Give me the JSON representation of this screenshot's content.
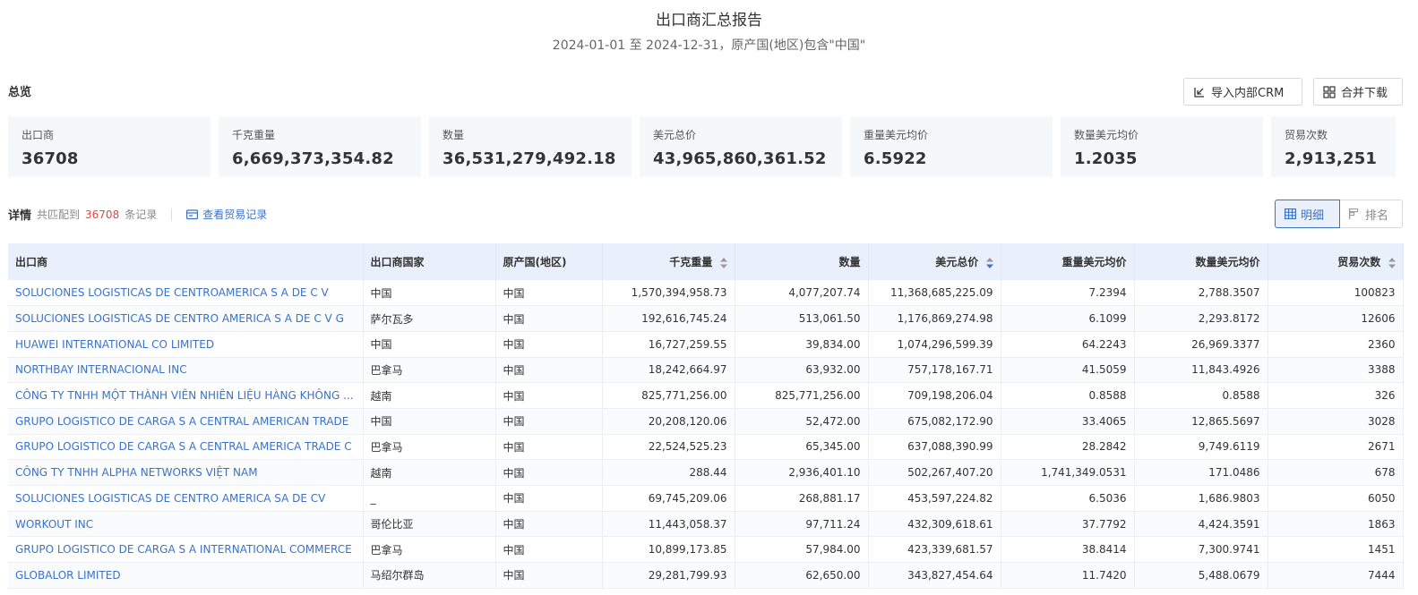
{
  "header": {
    "title": "出口商汇总报告",
    "subtitle": "2024-01-01 至 2024-12-31，原产国(地区)包含\"中国\""
  },
  "overview": {
    "label": "总览",
    "import_crm_label": "导入内部CRM",
    "merge_download_label": "合并下载"
  },
  "stats": [
    {
      "label": "出口商",
      "value": "36708"
    },
    {
      "label": "千克重量",
      "value": "6,669,373,354.82"
    },
    {
      "label": "数量",
      "value": "36,531,279,492.18"
    },
    {
      "label": "美元总价",
      "value": "43,965,860,361.52"
    },
    {
      "label": "重量美元均价",
      "value": "6.5922"
    },
    {
      "label": "数量美元均价",
      "value": "1.2035"
    },
    {
      "label": "贸易次数",
      "value": "2,913,251"
    }
  ],
  "details": {
    "label": "详情",
    "match_prefix": "共匹配到",
    "match_count": "36708",
    "match_suffix": "条记录",
    "view_records_label": "查看贸易记录",
    "view_detail_label": "明细",
    "view_rank_label": "排名"
  },
  "table": {
    "columns": [
      "出口商",
      "出口商国家",
      "原产国(地区)",
      "千克重量",
      "数量",
      "美元总价",
      "重量美元均价",
      "数量美元均价",
      "贸易次数"
    ],
    "rows": [
      [
        "SOLUCIONES LOGISTICAS DE CENTROAMERICA S A DE C V",
        "中国",
        "中国",
        "1,570,394,958.73",
        "4,077,207.74",
        "11,368,685,225.09",
        "7.2394",
        "2,788.3507",
        "100823"
      ],
      [
        "SOLUCIONES LOGISTICAS DE CENTRO AMERICA S A DE C V G",
        "萨尔瓦多",
        "中国",
        "192,616,745.24",
        "513,061.50",
        "1,176,869,274.98",
        "6.1099",
        "2,293.8172",
        "12606"
      ],
      [
        "HUAWEI INTERNATIONAL CO LIMITED",
        "中国",
        "中国",
        "16,727,259.55",
        "39,834.00",
        "1,074,296,599.39",
        "64.2243",
        "26,969.3377",
        "2360"
      ],
      [
        "NORTHBAY INTERNACIONAL INC",
        "巴拿马",
        "中国",
        "18,242,664.97",
        "63,932.00",
        "757,178,167.71",
        "41.5059",
        "11,843.4926",
        "3388"
      ],
      [
        "CÔNG TY TNHH MỘT THÀNH VIÊN NHIÊN LIỆU HÀNG KHÔNG ...",
        "越南",
        "中国",
        "825,771,256.00",
        "825,771,256.00",
        "709,198,206.04",
        "0.8588",
        "0.8588",
        "326"
      ],
      [
        "GRUPO LOGISTICO DE CARGA S A CENTRAL AMERICAN TRADE",
        "中国",
        "中国",
        "20,208,120.06",
        "52,472.00",
        "675,082,172.90",
        "33.4065",
        "12,865.5697",
        "3028"
      ],
      [
        "GRUPO LOGISTICO DE CARGA S A CENTRAL AMERICA TRADE C",
        "巴拿马",
        "中国",
        "22,524,525.23",
        "65,345.00",
        "637,088,390.99",
        "28.2842",
        "9,749.6119",
        "2671"
      ],
      [
        "CÔNG TY TNHH ALPHA NETWORKS VIỆT NAM",
        "越南",
        "中国",
        "288.44",
        "2,936,401.10",
        "502,267,407.20",
        "1,741,349.0531",
        "171.0486",
        "678"
      ],
      [
        "SOLUCIONES LOGISTICAS DE CENTRO AMERICA SA DE CV",
        "_",
        "中国",
        "69,745,209.06",
        "268,881.17",
        "453,597,224.82",
        "6.5036",
        "1,686.9803",
        "6050"
      ],
      [
        "WORKOUT INC",
        "哥伦比亚",
        "中国",
        "11,443,058.37",
        "97,711.24",
        "432,309,618.61",
        "37.7792",
        "4,424.3591",
        "1863"
      ],
      [
        "GRUPO LOGISTICO DE CARGA S A INTERNATIONAL COMMERCE",
        "巴拿马",
        "中国",
        "10,899,173.85",
        "57,984.00",
        "423,339,681.57",
        "38.8414",
        "7,300.9741",
        "1451"
      ],
      [
        "GLOBALOR LIMITED",
        "马绍尔群岛",
        "中国",
        "29,281,799.93",
        "62,650.00",
        "343,827,454.64",
        "11.7420",
        "5,488.0679",
        "7444"
      ]
    ]
  },
  "colors": {
    "accent": "#3a72c8",
    "count_red": "#e4453b",
    "header_bg": "#eaf0fb",
    "card_bg": "#f6f7f9"
  },
  "icons": {
    "import": "import-icon",
    "merge": "merge-download-icon",
    "records": "trade-records-icon",
    "detail": "table-grid-icon",
    "rank": "rank-bars-icon",
    "sort": "sort-icon"
  }
}
